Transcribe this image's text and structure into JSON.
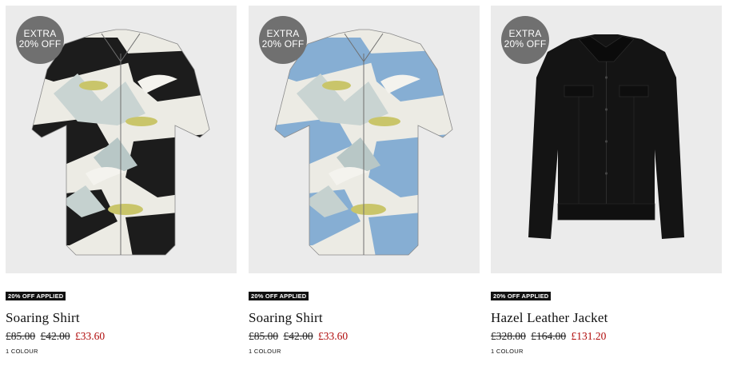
{
  "products": [
    {
      "badge_line1": "EXTRA",
      "badge_line2": "20% OFF",
      "applied_label": "20% OFF APPLIED",
      "name": "Soaring Shirt",
      "price_original": "£85.00",
      "price_previous": "£42.00",
      "price_current": "£33.60",
      "colour_count": "1 COLOUR",
      "image_icon": "printed-shirt-icon",
      "base_color": "#1c1c1c"
    },
    {
      "badge_line1": "EXTRA",
      "badge_line2": "20% OFF",
      "applied_label": "20% OFF APPLIED",
      "name": "Soaring Shirt",
      "price_original": "£85.00",
      "price_previous": "£42.00",
      "price_current": "£33.60",
      "colour_count": "1 COLOUR",
      "image_icon": "printed-shirt-icon",
      "base_color": "#86aed3"
    },
    {
      "badge_line1": "EXTRA",
      "badge_line2": "20% OFF",
      "applied_label": "20% OFF APPLIED",
      "name": "Hazel Leather Jacket",
      "price_original": "£328.00",
      "price_previous": "£164.00",
      "price_current": "£131.20",
      "colour_count": "1 COLOUR",
      "image_icon": "leather-jacket-icon",
      "base_color": "#141414"
    }
  ],
  "colors": {
    "image_background": "#ebebeb",
    "badge_background": "#707070",
    "sale_price": "#b00b0b",
    "applied_tag_background": "#111111"
  }
}
